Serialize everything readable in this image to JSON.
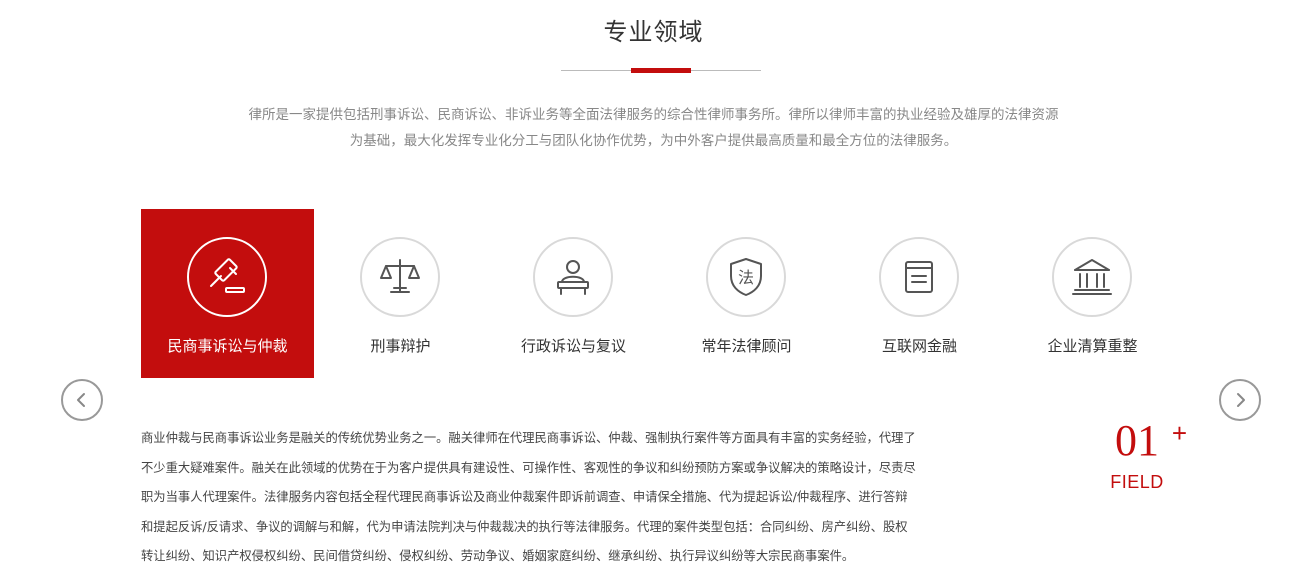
{
  "header": {
    "title": "专业领域",
    "intro_line1": "律所是一家提供包括刑事诉讼、民商诉讼、非诉业务等全面法律服务的综合性律师事务所。律所以律师丰富的执业经验及雄厚的法律资源",
    "intro_line2": "为基础，最大化发挥专业化分工与团队化协作优势，为中外客户提供最高质量和最全方位的法律服务。"
  },
  "tabs": [
    {
      "label": "民商事诉讼与仲裁",
      "icon": "gavel-icon",
      "active": true
    },
    {
      "label": "刑事辩护",
      "icon": "scales-icon",
      "active": false
    },
    {
      "label": "行政诉讼与复议",
      "icon": "person-desk-icon",
      "active": false
    },
    {
      "label": "常年法律顾问",
      "icon": "law-shield-icon",
      "active": false
    },
    {
      "label": "互联网金融",
      "icon": "document-icon",
      "active": false
    },
    {
      "label": "企业清算重整",
      "icon": "bank-building-icon",
      "active": false
    }
  ],
  "detail": {
    "line1": "商业仲裁与民商事诉讼业务是融关的传统优势业务之一。融关律师在代理民商事诉讼、仲裁、强制执行案件等方面具有丰富的实务经验，代理了",
    "line2": "不少重大疑难案件。融关在此领域的优势在于为客户提供具有建设性、可操作性、客观性的争议和纠纷预防方案或争议解决的策略设计，尽责尽",
    "line3": "职为当事人代理案件。法律服务内容包括全程代理民商事诉讼及商业仲裁案件即诉前调查、申请保全措施、代为提起诉讼/仲裁程序、进行答辩",
    "line4": "和提起反诉/反请求、争议的调解与和解，代为申请法院判决与仲裁裁决的执行等法律服务。代理的案件类型包括：合同纠纷、房产纠纷、股权",
    "line5": "转让纠纷、知识产权侵权纠纷、民间借贷纠纷、侵权纠纷、劳动争议、婚姻家庭纠纷、继承纠纷、执行异议纠纷等大宗民商事案件。"
  },
  "counter": {
    "number": "01",
    "plus": "+",
    "label": "FIELD"
  },
  "colors": {
    "accent": "#c30d0d",
    "muted_text": "#888888",
    "circle_border": "#d9d9d9"
  },
  "nav": {
    "prev_icon": "chevron-left-icon",
    "next_icon": "chevron-right-icon"
  }
}
